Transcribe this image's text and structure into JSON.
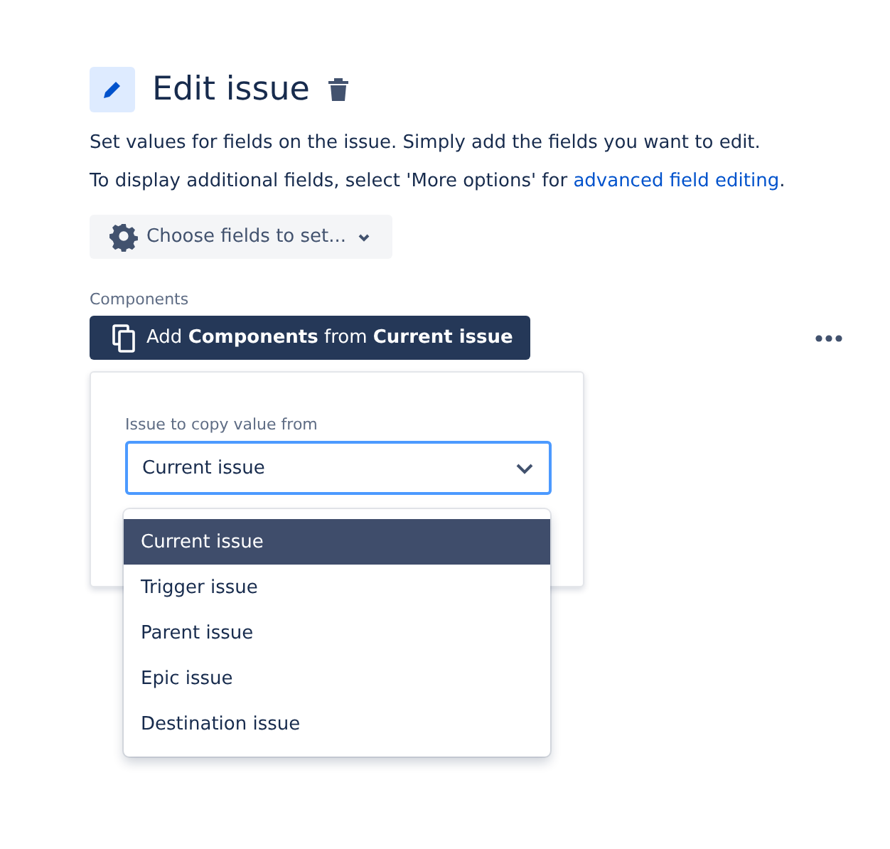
{
  "header": {
    "title": "Edit issue"
  },
  "description": "Set values for fields on the issue. Simply add the fields you want to edit.",
  "hint": {
    "prefix": "To display additional fields, select 'More options' for ",
    "link": "advanced field editing",
    "suffix": "."
  },
  "choose_button": {
    "label": "Choose fields to set..."
  },
  "field": {
    "label": "Components",
    "action": "Add **Components** from **Current issue**"
  },
  "popup": {
    "label": "Issue to copy value from",
    "select": {
      "value": "Current issue",
      "expanded": true
    },
    "options": [
      {
        "label": "Current issue",
        "selected": true
      },
      {
        "label": "Trigger issue",
        "selected": false
      },
      {
        "label": "Parent issue",
        "selected": false
      },
      {
        "label": "Epic issue",
        "selected": false
      },
      {
        "label": "Destination issue",
        "selected": false
      }
    ]
  }
}
